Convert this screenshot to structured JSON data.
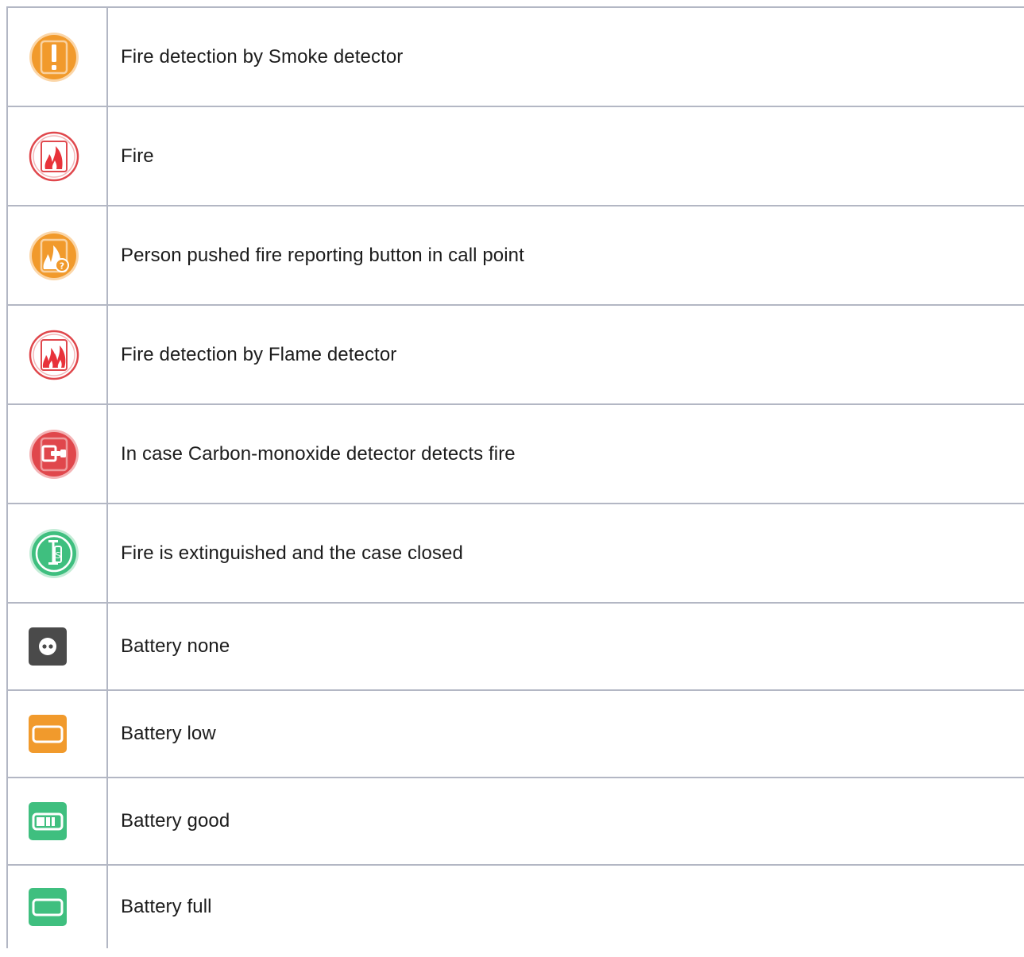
{
  "rows": [
    {
      "label": "Fire detection by Smoke detector",
      "icon": "smoke-alert-icon",
      "color": "#f19a2c"
    },
    {
      "label": "Fire",
      "icon": "fire-icon",
      "color": "#e0474c"
    },
    {
      "label": "Person pushed fire reporting button in call point",
      "icon": "call-point-icon",
      "color": "#f19a2c"
    },
    {
      "label": "Fire detection by Flame detector",
      "icon": "flame-detector-icon",
      "color": "#e0474c"
    },
    {
      "label": "In case Carbon-monoxide detector detects fire",
      "icon": "co-detector-icon",
      "color": "#e0474c"
    },
    {
      "label": "Fire is extinguished and the case closed",
      "icon": "extinguisher-icon",
      "color": "#3fbf7f"
    },
    {
      "label": "Battery none",
      "icon": "battery-none-icon",
      "color": "#4a4a4a"
    },
    {
      "label": "Battery low",
      "icon": "battery-low-icon",
      "color": "#f19a2c"
    },
    {
      "label": "Battery good",
      "icon": "battery-good-icon",
      "color": "#3fbf7f"
    },
    {
      "label": "Battery full",
      "icon": "battery-full-icon",
      "color": "#3fbf7f"
    }
  ]
}
